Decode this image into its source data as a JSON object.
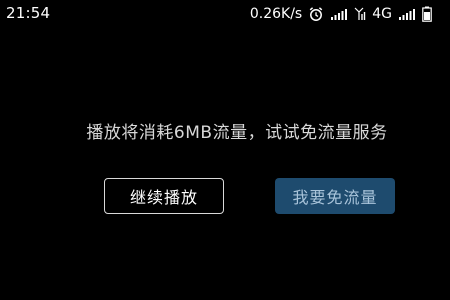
{
  "status_bar": {
    "time": "21:54",
    "net_speed": "0.26K/s",
    "network_type": "4G",
    "icons": [
      "alarm-icon",
      "signal-icon",
      "signal-icon",
      "battery-icon"
    ]
  },
  "prompt": {
    "message": "播放将消耗6MB流量，试试免流量服务"
  },
  "buttons": {
    "continue_label": "继续播放",
    "free_label": "我要免流量"
  },
  "colors": {
    "background": "#000000",
    "free_button_bg": "#1e4b6e",
    "free_button_text": "#a9c4da",
    "outline": "#d9d9d9"
  }
}
